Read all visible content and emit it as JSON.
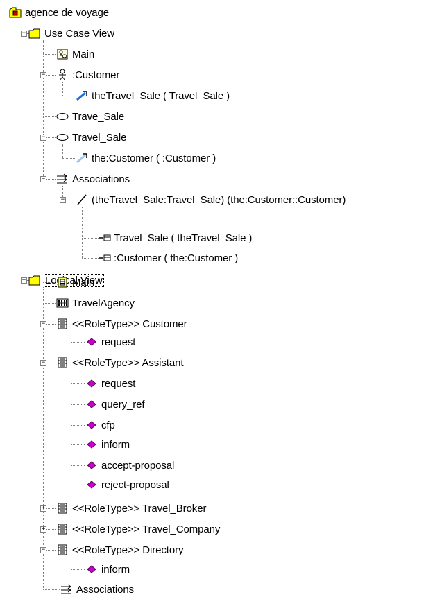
{
  "tree": {
    "root": {
      "label": "agence de voyage",
      "icon": "package-icon"
    },
    "use_case_view": {
      "label": "Use Case View",
      "icon": "folder-icon",
      "toggle": "−",
      "items": {
        "main": {
          "label": "Main",
          "icon": "use-case-diagram-icon"
        },
        "customer": {
          "label": ":Customer",
          "icon": "actor-icon",
          "toggle": "−",
          "child": {
            "label": "theTravel_Sale ( Travel_Sale )",
            "icon": "role-link-icon"
          }
        },
        "trave_sale": {
          "label": "Trave_Sale",
          "icon": "use-case-icon"
        },
        "travel_sale": {
          "label": "Travel_Sale",
          "icon": "use-case-icon",
          "toggle": "−",
          "child": {
            "label": "the:Customer ( :Customer )",
            "icon": "role-link-icon"
          }
        },
        "associations": {
          "label": "Associations",
          "icon": "associations-icon",
          "toggle": "−",
          "assoc": {
            "label": "(theTravel_Sale:Travel_Sale) (the:Customer::Customer)",
            "icon": "association-icon",
            "toggle": "−",
            "roles": [
              {
                "label": "Travel_Sale ( theTravel_Sale )",
                "icon": "role-icon"
              },
              {
                "label": ":Customer ( the:Customer )",
                "icon": "role-icon"
              }
            ]
          }
        }
      }
    },
    "logical_view": {
      "label": "Logical View",
      "icon": "folder-icon",
      "toggle": "−",
      "items": {
        "main": {
          "label": "Main",
          "icon": "class-diagram-icon"
        },
        "travel_agency": {
          "label": "TravelAgency",
          "icon": "component-icon"
        },
        "customer": {
          "label": "<<RoleType>> Customer",
          "icon": "class-icon",
          "toggle": "−",
          "ops": [
            "request"
          ]
        },
        "assistant": {
          "label": "<<RoleType>> Assistant",
          "icon": "class-icon",
          "toggle": "−",
          "ops": [
            "request",
            "query_ref",
            "cfp",
            "inform",
            "accept-proposal",
            "reject-proposal"
          ]
        },
        "travel_broker": {
          "label": "<<RoleType>> Travel_Broker",
          "icon": "class-icon",
          "toggle": "+"
        },
        "travel_company": {
          "label": "<<RoleType>> Travel_Company",
          "icon": "class-icon",
          "toggle": "+"
        },
        "directory": {
          "label": "<<RoleType>> Directory",
          "icon": "class-icon",
          "toggle": "−",
          "ops": [
            "inform"
          ]
        },
        "associations": {
          "label": "Associations",
          "icon": "associations-icon"
        }
      }
    }
  },
  "colors": {
    "folder": "#ffff00",
    "operation": "#cc00cc",
    "connector": "#808080",
    "link": "#1e6fd6"
  }
}
